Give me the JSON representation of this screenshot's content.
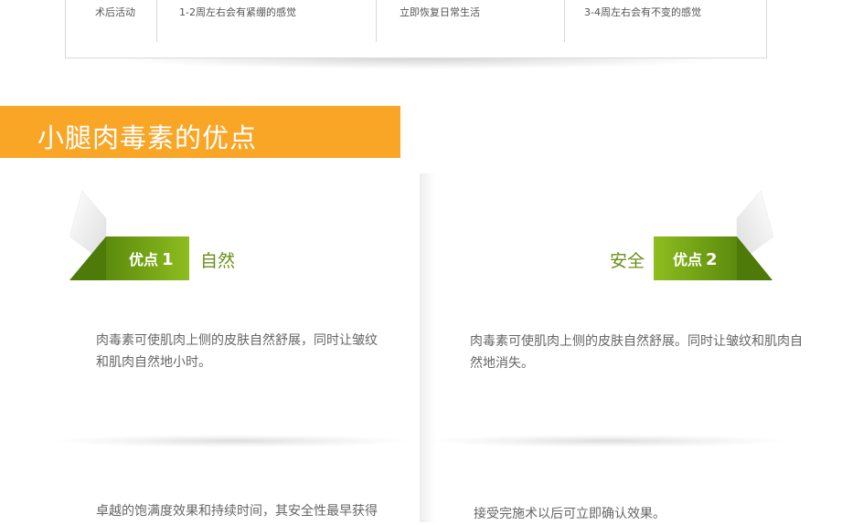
{
  "top_table": {
    "row_label": "术后活动",
    "cells": [
      "1-2周左右会有紧绷的感觉",
      "立即恢复日常生活",
      "3-4周左右会有不变的感觉"
    ]
  },
  "section": {
    "title": "小腿肉毒素的优点"
  },
  "advantages": [
    {
      "tag": "优点",
      "number": "1",
      "title": "自然",
      "text": "肉毒素可使肌肉上侧的皮肤自然舒展，同时让皱纹和肌肉自然地小时。"
    },
    {
      "tag": "优点",
      "number": "2",
      "title": "安全",
      "text": "肉毒素可使肌肉上侧的皮肤自然舒展。同时让皱纹和肌肉自然地消失。"
    },
    {
      "text": "卓越的饱满度效果和持续时间，其安全性最早获得"
    },
    {
      "text": "接受完施术以后可立即确认效果。"
    }
  ],
  "colors": {
    "banner": "#f9a526",
    "ribbon_green_dark": "#5c8a0d",
    "ribbon_green_light": "#8ebd1f",
    "title_green": "#6a8f16"
  }
}
